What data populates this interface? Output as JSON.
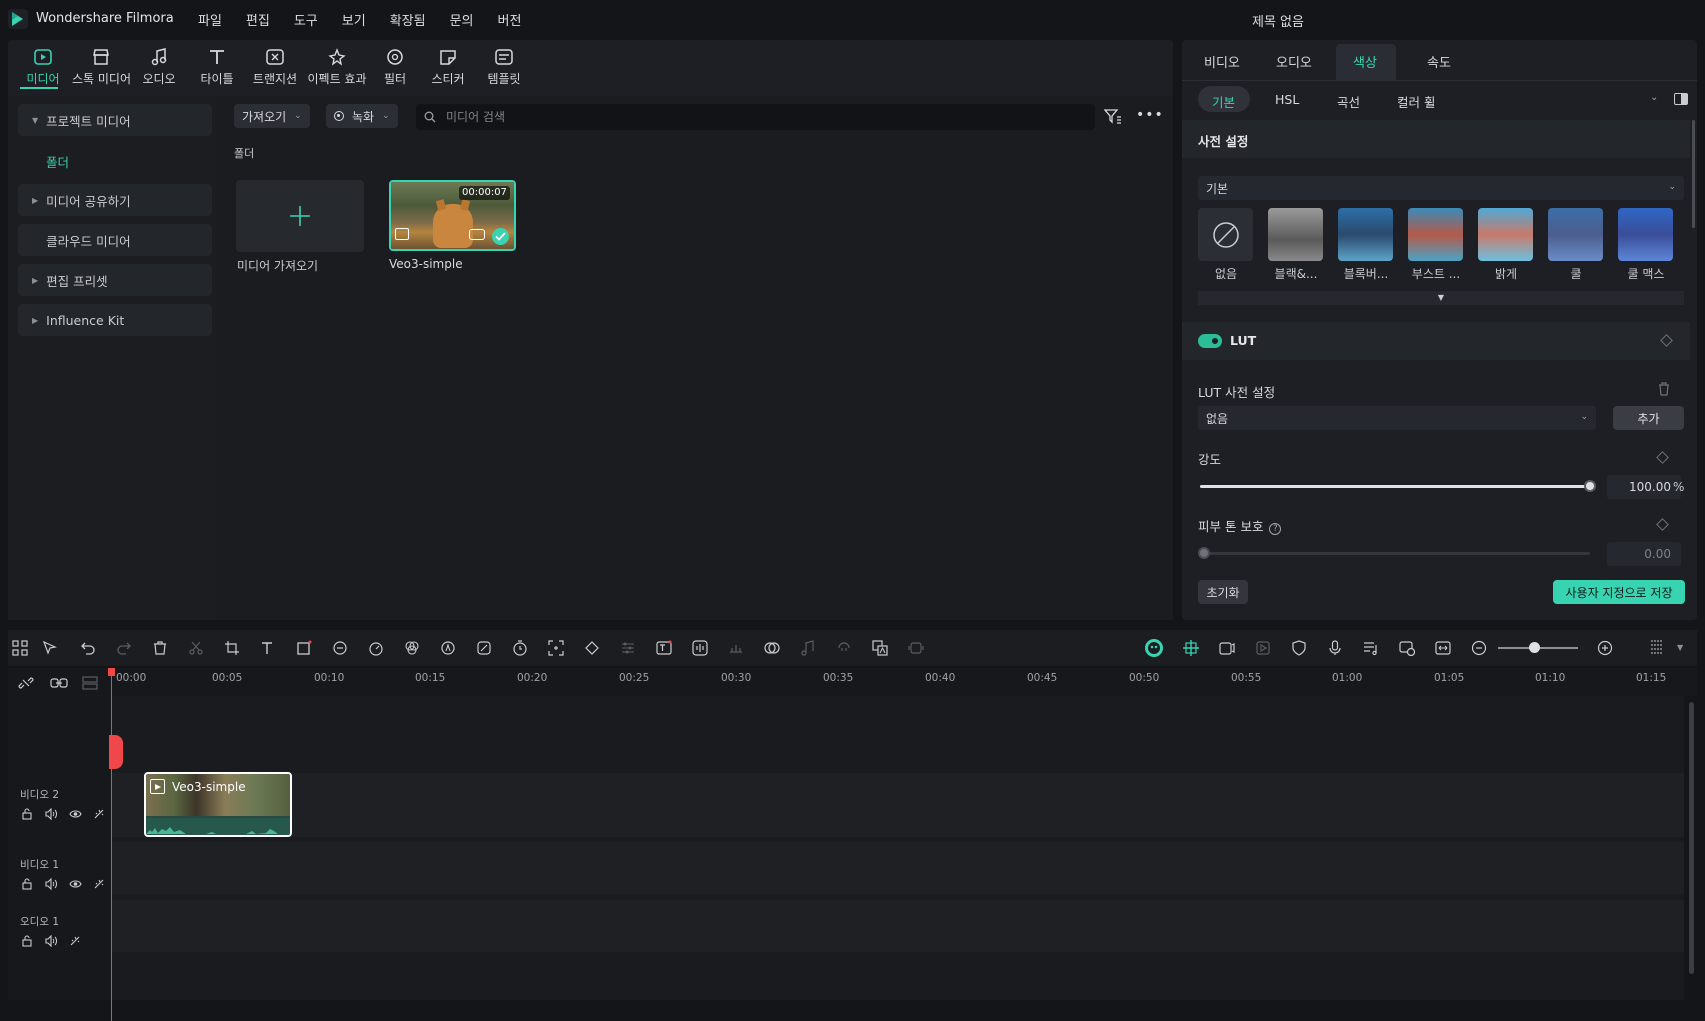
{
  "app": {
    "name": "Wondershare Filmora",
    "document_title": "제목 없음",
    "menu": [
      "파일",
      "편집",
      "도구",
      "보기",
      "확장됨",
      "문의",
      "버전"
    ]
  },
  "toolbar": {
    "items": [
      "미디어",
      "스톡 미디어",
      "오디오",
      "타이틀",
      "트랜지션",
      "이펙트 효과",
      "필터",
      "스티커",
      "템플릿"
    ],
    "active": "미디어"
  },
  "sidebar": {
    "project_media": "프로젝트 미디어",
    "folder": "폴더",
    "share_media": "미디어 공유하기",
    "cloud_media": "클라우드 미디어",
    "edit_presets": "편집 프리셋",
    "influence_kit": "Influence Kit"
  },
  "media": {
    "import_dropdown": "가져오기",
    "record_dropdown": "녹화",
    "search_placeholder": "미디어 검색",
    "folder_label": "폴더",
    "import_card_label": "미디어 가져오기",
    "clip_name": "Veo3-simple",
    "clip_duration": "00:00:07"
  },
  "properties": {
    "tabs": [
      "비디오",
      "오디오",
      "색상",
      "속도"
    ],
    "active_tab": "색상",
    "subtabs": [
      "기본",
      "HSL",
      "곡선",
      "컬러 휠"
    ],
    "active_subtab": "기본",
    "preset_section": "사전 설정",
    "preset_category": "기본",
    "presets": [
      "없음",
      "블랙&...",
      "블록버...",
      "부스트 ...",
      "밝게",
      "쿨",
      "쿨 맥스"
    ],
    "lut_title": "LUT",
    "lut_enabled": true,
    "lut_preset_label": "LUT 사전 설정",
    "lut_value": "없음",
    "add_button": "추가",
    "intensity_label": "강도",
    "intensity_value": "100.00",
    "intensity_unit": "%",
    "intensity_fraction": 1.0,
    "skin_label": "피부 톤 보호",
    "skin_value": "0.00",
    "skin_fraction": 0.0,
    "reset_button": "초기화",
    "save_button": "사용자 지정으로 저장"
  },
  "timeline": {
    "ticks": [
      "00:00",
      "00:05",
      "00:10",
      "00:15",
      "00:20",
      "00:25",
      "00:30",
      "00:35",
      "00:40",
      "00:45",
      "00:50",
      "00:55",
      "01:00",
      "01:05",
      "01:10",
      "01:15"
    ],
    "tracks": [
      "비디오 2",
      "비디오 1",
      "오디오 1"
    ],
    "clip_label": "Veo3-simple",
    "zoom_fraction": 0.45
  },
  "colors": {
    "accent": "#38d3b0",
    "playhead": "#f0484a",
    "panel": "#1d1f24",
    "background": "#141519"
  }
}
